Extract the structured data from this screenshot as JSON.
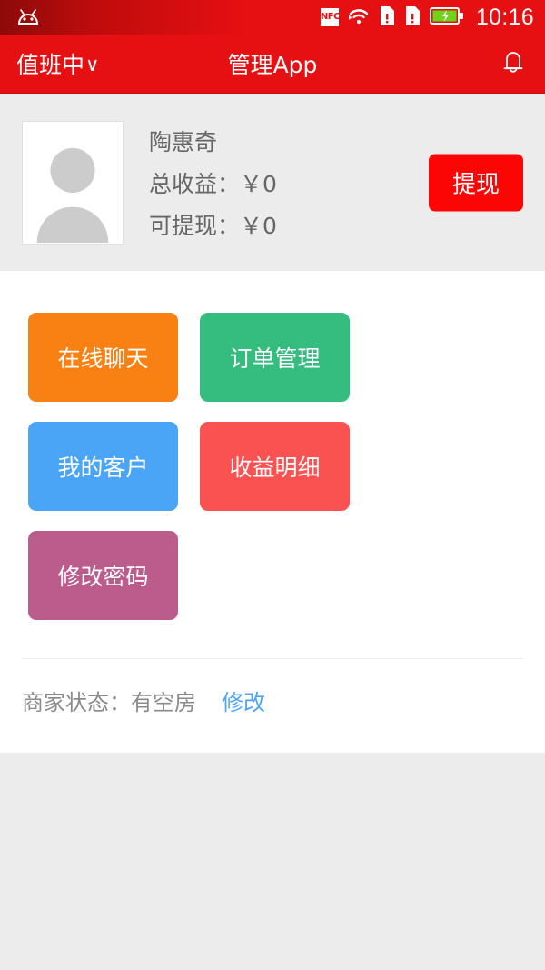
{
  "status_bar": {
    "time": "10:16",
    "nfc_label": "NFC",
    "icons": [
      "android-robot-icon",
      "nfc-icon",
      "wifi-icon",
      "sim1-icon",
      "sim2-icon",
      "battery-charging-icon"
    ],
    "background_color": "#e60f12"
  },
  "header": {
    "duty_status": "值班中",
    "duty_chevron": "∨",
    "title": "管理App",
    "bell_icon": "notification-bell-icon",
    "background_color": "#e60f12"
  },
  "profile": {
    "avatar_alt": "default-user-avatar",
    "name": "陶惠奇",
    "total_earnings_label": "总收益：￥0",
    "withdrawable_label": "可提现：￥0",
    "withdraw_button": "提现",
    "withdraw_button_color": "#fc0505"
  },
  "tiles": [
    {
      "label": "在线聊天",
      "color": "#f98012",
      "name": "online-chat"
    },
    {
      "label": "订单管理",
      "color": "#34bd7e",
      "name": "order-management"
    },
    {
      "label": "我的客户",
      "color": "#4ba5f7",
      "name": "my-customers"
    },
    {
      "label": "收益明细",
      "color": "#fa5250",
      "name": "earnings-detail"
    },
    {
      "label": "修改密码",
      "color": "#bb5c8c",
      "name": "change-password"
    }
  ],
  "shop_status": {
    "label": "商家状态：有空房",
    "edit_link": "修改",
    "link_color": "#4ca6f5"
  }
}
